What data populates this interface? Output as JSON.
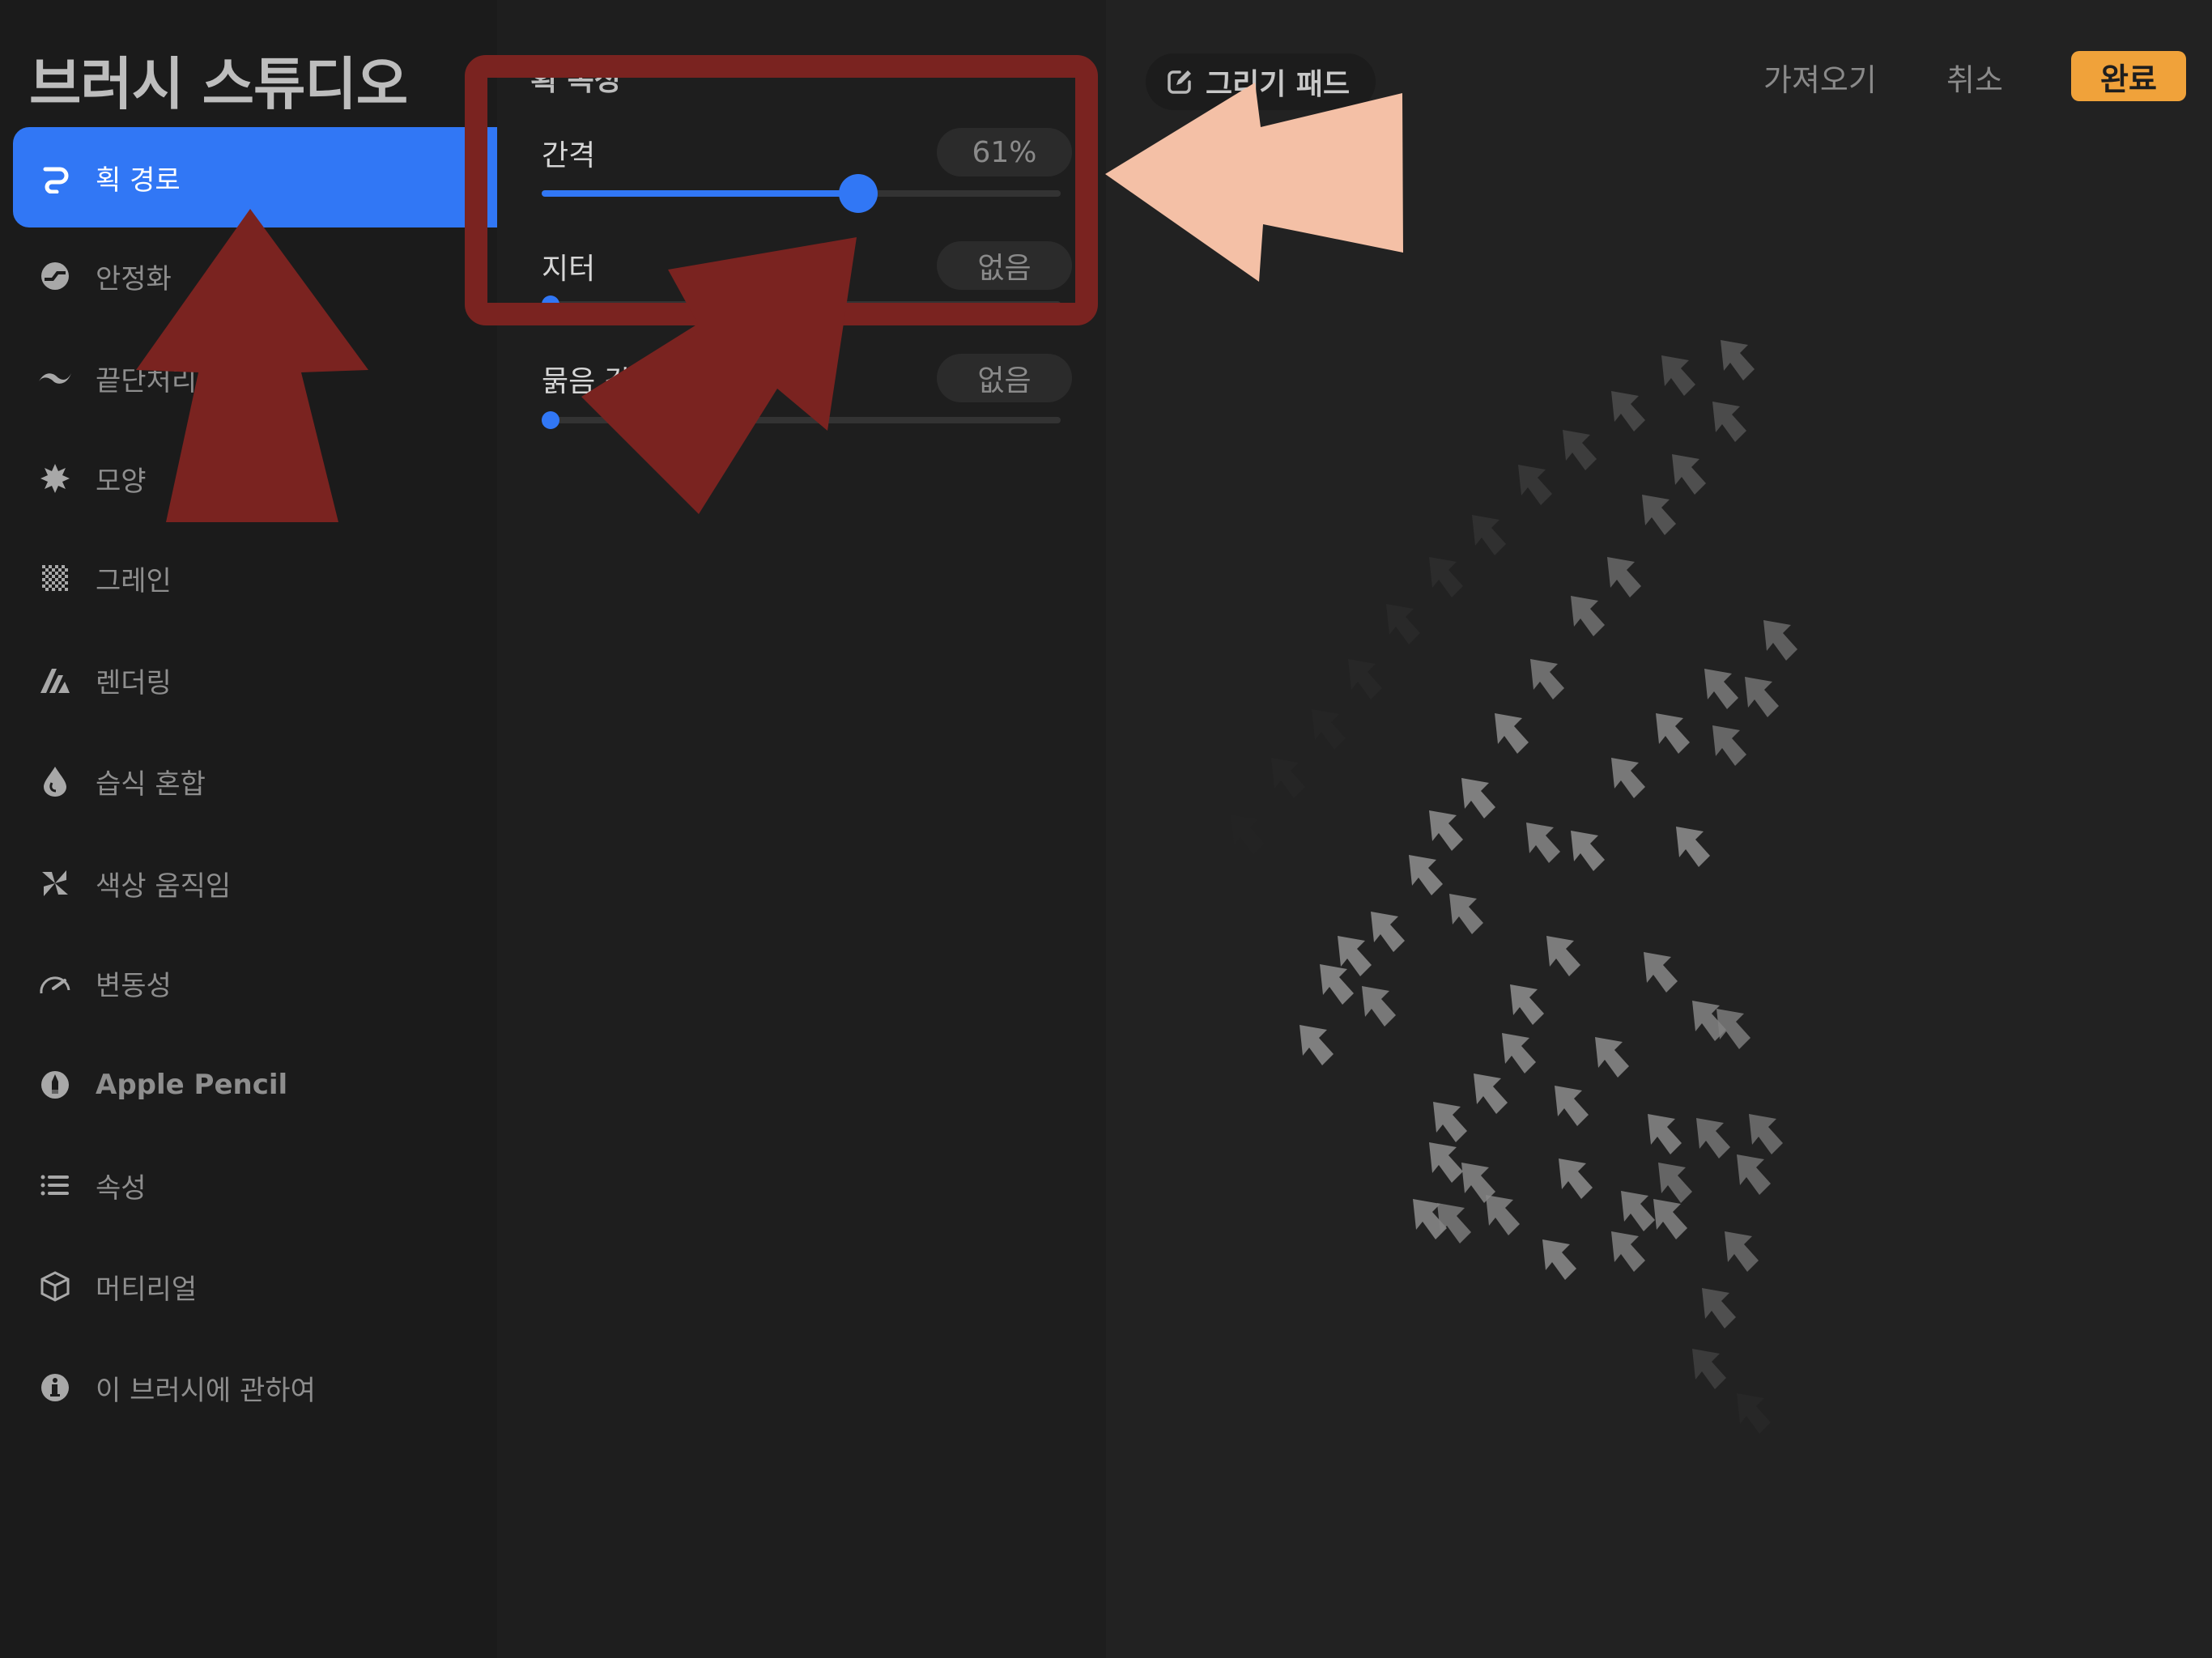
{
  "app": {
    "title": "브러시 스튜디오"
  },
  "colors": {
    "accent": "#3177f5",
    "done_button": "#f0a23a",
    "annotation_red": "#7a2320",
    "annotation_peach": "#f4c0a6"
  },
  "sidebar": {
    "selected_index": 0,
    "items": [
      {
        "label": "획 경로",
        "icon": "stroke-path-icon"
      },
      {
        "label": "안정화",
        "icon": "stabilization-icon"
      },
      {
        "label": "끝단처리",
        "icon": "taper-icon"
      },
      {
        "label": "모양",
        "icon": "shape-icon"
      },
      {
        "label": "그레인",
        "icon": "grain-icon"
      },
      {
        "label": "렌더링",
        "icon": "rendering-icon"
      },
      {
        "label": "습식 혼합",
        "icon": "wet-mix-icon"
      },
      {
        "label": "색상 움직임",
        "icon": "color-dynamics-icon"
      },
      {
        "label": "변동성",
        "icon": "dynamics-icon"
      },
      {
        "label": "Apple Pencil",
        "icon": "apple-pencil-icon"
      },
      {
        "label": "속성",
        "icon": "properties-icon"
      },
      {
        "label": "머티리얼",
        "icon": "materials-icon"
      },
      {
        "label": "이 브러시에 관하여",
        "icon": "about-icon"
      }
    ]
  },
  "panel": {
    "section_title": "획 속성",
    "rows": [
      {
        "label": "간격",
        "value": "61%",
        "fraction": 0.61
      },
      {
        "label": "지터",
        "value": "없음",
        "fraction": 0
      },
      {
        "label": "묽음 감소",
        "value": "없음",
        "fraction": 0
      }
    ]
  },
  "topbar": {
    "drawing_pad_label": "그리기 패드",
    "import_label": "가져오기",
    "cancel_label": "취소",
    "done_label": "완료"
  }
}
